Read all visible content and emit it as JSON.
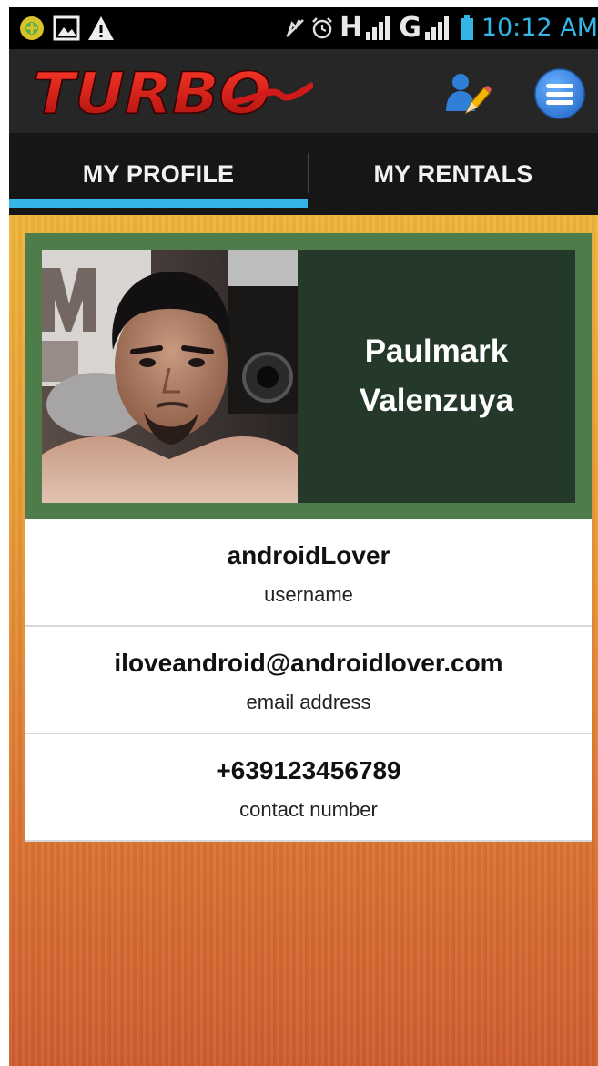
{
  "status_bar": {
    "network_type": "H",
    "network_type_2": "G",
    "time": "10:12 AM"
  },
  "app": {
    "logo_text": "TURBO"
  },
  "tabs": [
    {
      "label": "MY PROFILE",
      "selected": true
    },
    {
      "label": "MY RENTALS",
      "selected": false
    }
  ],
  "profile": {
    "name_line1": "Paulmark",
    "name_line2": "Valenzuya",
    "fields": [
      {
        "value": "androidLover",
        "label": "username"
      },
      {
        "value": "iloveandroid@androidlover.com",
        "label": "email address"
      },
      {
        "value": "+639123456789",
        "label": "contact number"
      }
    ]
  },
  "colors": {
    "accent": "#33b5e5",
    "card_green": "#4e7c4b",
    "name_panel": "#25392a",
    "logo_red": "#d01a1a"
  }
}
